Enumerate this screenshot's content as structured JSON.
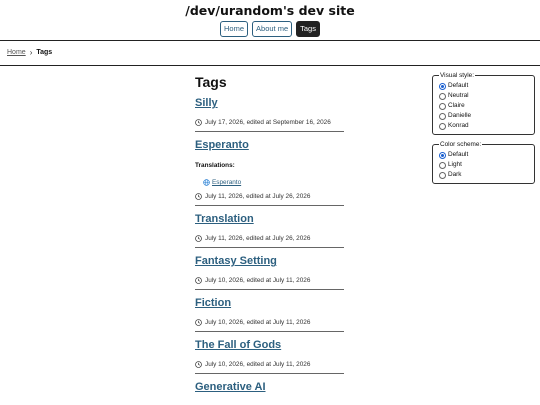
{
  "header": {
    "site_title": "/dev/urandom's dev site",
    "nav": [
      {
        "label": "Home",
        "active": false
      },
      {
        "label": "About me",
        "active": false
      },
      {
        "label": "Tags",
        "active": true
      }
    ]
  },
  "breadcrumb": {
    "home": "Home",
    "separator": "›",
    "current": "Tags"
  },
  "main": {
    "page_title": "Tags",
    "posts": [
      {
        "title": "Silly",
        "meta": "July 17, 2026, edited at September 16, 2026"
      },
      {
        "title": "Esperanto",
        "translations_label": "Translations:",
        "translation_link": "Esperanto",
        "meta": "July 11, 2026, edited at July 26, 2026"
      },
      {
        "title": "Translation",
        "meta": "July 11, 2026, edited at July 26, 2026"
      },
      {
        "title": "Fantasy Setting",
        "meta": "July 10, 2026, edited at July 11, 2026"
      },
      {
        "title": "Fiction",
        "meta": "July 10, 2026, edited at July 11, 2026"
      },
      {
        "title": "The Fall of Gods",
        "meta": "July 10, 2026, edited at July 11, 2026"
      },
      {
        "title": "Generative AI"
      }
    ]
  },
  "visual_style": {
    "legend": "Visual style:",
    "options": [
      {
        "label": "Default",
        "checked": true
      },
      {
        "label": "Neutral",
        "checked": false
      },
      {
        "label": "Claire",
        "checked": false
      },
      {
        "label": "Danielle",
        "checked": false
      },
      {
        "label": "Konrad",
        "checked": false
      }
    ]
  },
  "color_scheme": {
    "legend": "Color scheme:",
    "options": [
      {
        "label": "Default",
        "checked": true
      },
      {
        "label": "Light",
        "checked": false
      },
      {
        "label": "Dark",
        "checked": false
      }
    ]
  },
  "colors": {
    "link": "#2c5f7f",
    "active_nav_bg": "#222222",
    "radio_accent": "#1a5fd0"
  },
  "icons": {
    "meta_icon": "clock-icon",
    "translation_icon": "globe-icon"
  }
}
